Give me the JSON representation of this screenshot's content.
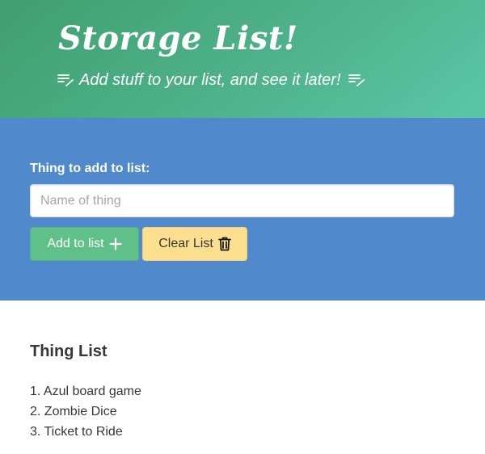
{
  "hero": {
    "title": "Storage List!",
    "subtitle": "Add stuff to your list, and see it later!",
    "icon": "note-pencil-icon"
  },
  "form": {
    "label": "Thing to add to list:",
    "input_value": "",
    "input_placeholder": "Name of thing",
    "add_button_label": "Add to list",
    "add_button_icon": "plus-icon",
    "clear_button_label": "Clear List",
    "clear_button_icon": "trash-icon"
  },
  "list": {
    "title": "Thing List",
    "items": [
      {
        "number": "1.",
        "text": "Azul board game"
      },
      {
        "number": "2.",
        "text": "Zombie Dice"
      },
      {
        "number": "3.",
        "text": "Ticket to Ride"
      }
    ]
  },
  "colors": {
    "hero_gradient_start": "#3f9f6e",
    "hero_gradient_end": "#5bc6a6",
    "form_background": "#5089cc",
    "add_button": "#5fc08a",
    "clear_button": "#fbdf8f"
  }
}
